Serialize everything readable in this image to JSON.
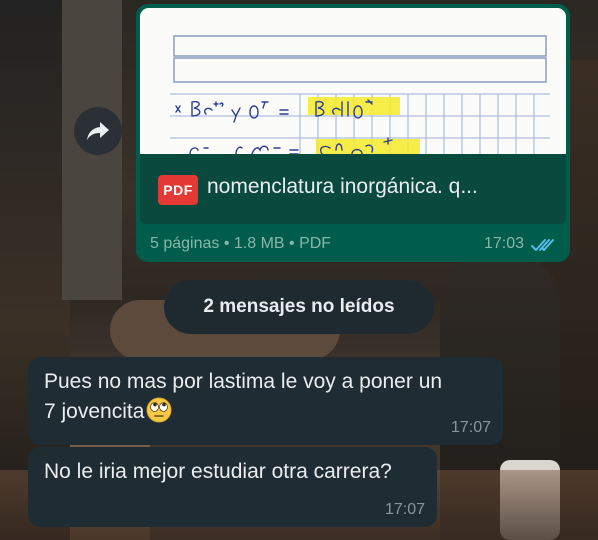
{
  "outgoing_document": {
    "file_name": "nomenclatura inorgánica. q...",
    "pdf_badge": "PDF",
    "meta": "5 páginas • 1.8 MB • PDF",
    "time": "17:03",
    "status": "read",
    "status_color": "#53bdeb"
  },
  "unread_banner": "2 mensajes no leídos",
  "messages": [
    {
      "text_line1": "Pues no mas por lastima le voy a poner un",
      "text_line2": "7 jovencita",
      "emoji": "face-with-rolling-eyes",
      "time": "17:07"
    },
    {
      "text": "No le iria mejor estudiar otra carrera?",
      "time": "17:07"
    }
  ],
  "colors": {
    "outgoing_bubble": "#005c4b",
    "incoming_bubble": "#202c33",
    "pdf_red": "#e53935"
  }
}
